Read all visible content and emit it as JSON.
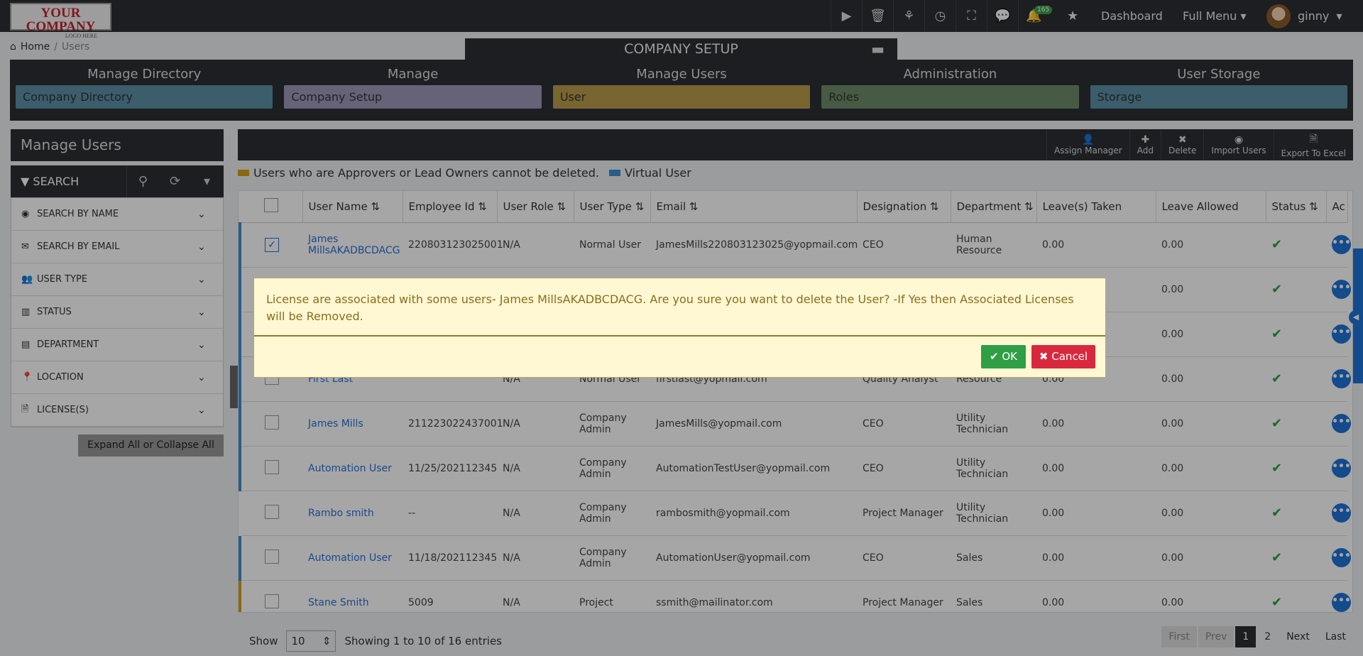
{
  "topbar": {
    "logo_line1": "YOUR COMPANY",
    "logo_line2": "LOGO HERE",
    "notification_count": "165",
    "dashboard": "Dashboard",
    "full_menu": "Full Menu",
    "username": "ginny"
  },
  "breadcrumb": {
    "home": "Home",
    "current": "Users"
  },
  "setup": {
    "title": "COMPANY SETUP",
    "columns": [
      {
        "heading": "Manage Directory",
        "item": "Company Directory",
        "color": "#5b8fa6"
      },
      {
        "heading": "Manage",
        "item": "Company Setup",
        "color": "#9d99b8"
      },
      {
        "heading": "Manage Users",
        "item": "User",
        "color": "#b89c4a"
      },
      {
        "heading": "Administration",
        "item": "Roles",
        "color": "#6e8a68"
      },
      {
        "heading": "User Storage",
        "item": "Storage",
        "color": "#5b8fa6"
      }
    ]
  },
  "sidebar": {
    "title": "Manage Users",
    "search_label": "SEARCH",
    "filters": [
      {
        "label": "SEARCH BY NAME",
        "icon": "user-circle-icon"
      },
      {
        "label": "SEARCH BY EMAIL",
        "icon": "envelope-icon"
      },
      {
        "label": "USER TYPE",
        "icon": "users-icon"
      },
      {
        "label": "STATUS",
        "icon": "bar-chart-icon"
      },
      {
        "label": "DEPARTMENT",
        "icon": "id-card-icon"
      },
      {
        "label": "LOCATION",
        "icon": "map-pin-icon"
      },
      {
        "label": "LICENSE(S)",
        "icon": "file-icon"
      }
    ],
    "expand_all": "Expand All or Collapse All"
  },
  "toolbar": {
    "assign_manager": "Assign Manager",
    "add": "Add",
    "delete": "Delete",
    "import_users": "Import Users",
    "export_excel": "Export To Excel"
  },
  "legend": {
    "approver_note": "Users who are Approvers or Lead Owners cannot be deleted.",
    "virtual_user": "Virtual User",
    "approver_color": "#d4a017",
    "virtual_color": "#3a8fd6"
  },
  "table": {
    "headers": [
      "User Name",
      "Employee Id",
      "User Role",
      "User Type",
      "Email",
      "Designation",
      "Department",
      "Leave(s) Taken",
      "Leave Allowed",
      "Status",
      "Ac"
    ],
    "rows": [
      {
        "name": "James MillsAKADBCDACG",
        "emp": "220803123025001",
        "role": "N/A",
        "type": "Normal User",
        "email": "JamesMills220803123025@yopmail.com",
        "desig": "CEO",
        "dept": "Human Resource",
        "taken": "0.00",
        "allowed": "0.00",
        "checked": "✓"
      },
      {
        "name": "",
        "emp": "",
        "role": "",
        "type": "",
        "email": "",
        "desig": "",
        "dept": "",
        "taken": "",
        "allowed": "0.00",
        "checked": ""
      },
      {
        "name": "",
        "emp": "",
        "role": "",
        "type": "",
        "email": "",
        "desig": "",
        "dept": "",
        "taken": "",
        "allowed": "0.00",
        "checked": ""
      },
      {
        "name": "First Last",
        "emp": "",
        "role": "N/A",
        "type": "Normal User",
        "email": "firstlast@yopmail.com",
        "desig": "Quality Analyst",
        "dept": "Resource",
        "taken": "0.00",
        "allowed": "0.00",
        "checked": ""
      },
      {
        "name": "James Mills",
        "emp": "211223022437001",
        "role": "N/A",
        "type": "Company Admin",
        "email": "JamesMills@yopmail.com",
        "desig": "CEO",
        "dept": "Utility Technician",
        "taken": "0.00",
        "allowed": "0.00",
        "checked": ""
      },
      {
        "name": "Automation User",
        "emp": "11/25/202112345",
        "role": "N/A",
        "type": "Company Admin",
        "email": "AutomationTestUser@yopmail.com",
        "desig": "CEO",
        "dept": "Utility Technician",
        "taken": "0.00",
        "allowed": "0.00",
        "checked": ""
      },
      {
        "name": "Rambo smith",
        "emp": "--",
        "role": "N/A",
        "type": "Company Admin",
        "email": "rambosmith@yopmail.com",
        "desig": "Project Manager",
        "dept": "Utility Technician",
        "taken": "0.00",
        "allowed": "0.00",
        "checked": ""
      },
      {
        "name": "Automation User",
        "emp": "11/18/202112345",
        "role": "N/A",
        "type": "Company Admin",
        "email": "AutomationUser@yopmail.com",
        "desig": "CEO",
        "dept": "Sales",
        "taken": "0.00",
        "allowed": "0.00",
        "checked": ""
      },
      {
        "name": "Stane Smith",
        "emp": "5009",
        "role": "N/A",
        "type": "Project",
        "email": "ssmith@mailinator.com",
        "desig": "Project Manager",
        "dept": "Sales",
        "taken": "0.00",
        "allowed": "0.00",
        "checked": ""
      }
    ]
  },
  "footer": {
    "show_label": "Show",
    "page_size": "10",
    "showing": "Showing 1 to 10 of 16 entries",
    "first": "First",
    "prev": "Prev",
    "page1": "1",
    "page2": "2",
    "next": "Next",
    "last": "Last"
  },
  "dialog": {
    "message": "License are associated with some users- James MillsAKADBCDACG. Are you sure you want to delete the User? -If Yes then Associated Licenses will be Removed.",
    "ok": "OK",
    "cancel": "Cancel"
  }
}
